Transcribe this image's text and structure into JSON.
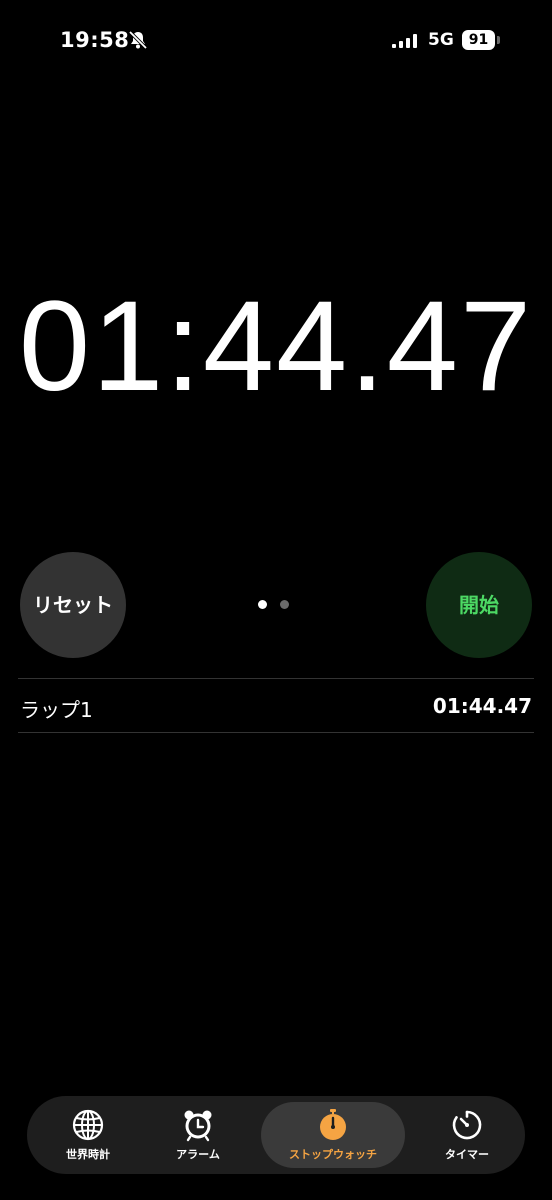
{
  "status_bar": {
    "time": "19:58",
    "network": "5G",
    "battery": "91"
  },
  "stopwatch": {
    "display": "01:44.47"
  },
  "controls": {
    "reset_label": "リセット",
    "start_label": "開始"
  },
  "laps": [
    {
      "name": "ラップ1",
      "time": "01:44.47"
    }
  ],
  "tabs": [
    {
      "label": "世界時計",
      "icon": "globe-icon"
    },
    {
      "label": "アラーム",
      "icon": "alarm-clock-icon"
    },
    {
      "label": "ストップウォッチ",
      "icon": "stopwatch-icon",
      "active": true
    },
    {
      "label": "タイマー",
      "icon": "timer-icon"
    }
  ],
  "colors": {
    "accent": "#f5a443",
    "start_text": "#4cd964",
    "start_bg": "#0f2b14",
    "reset_bg": "#333333"
  }
}
